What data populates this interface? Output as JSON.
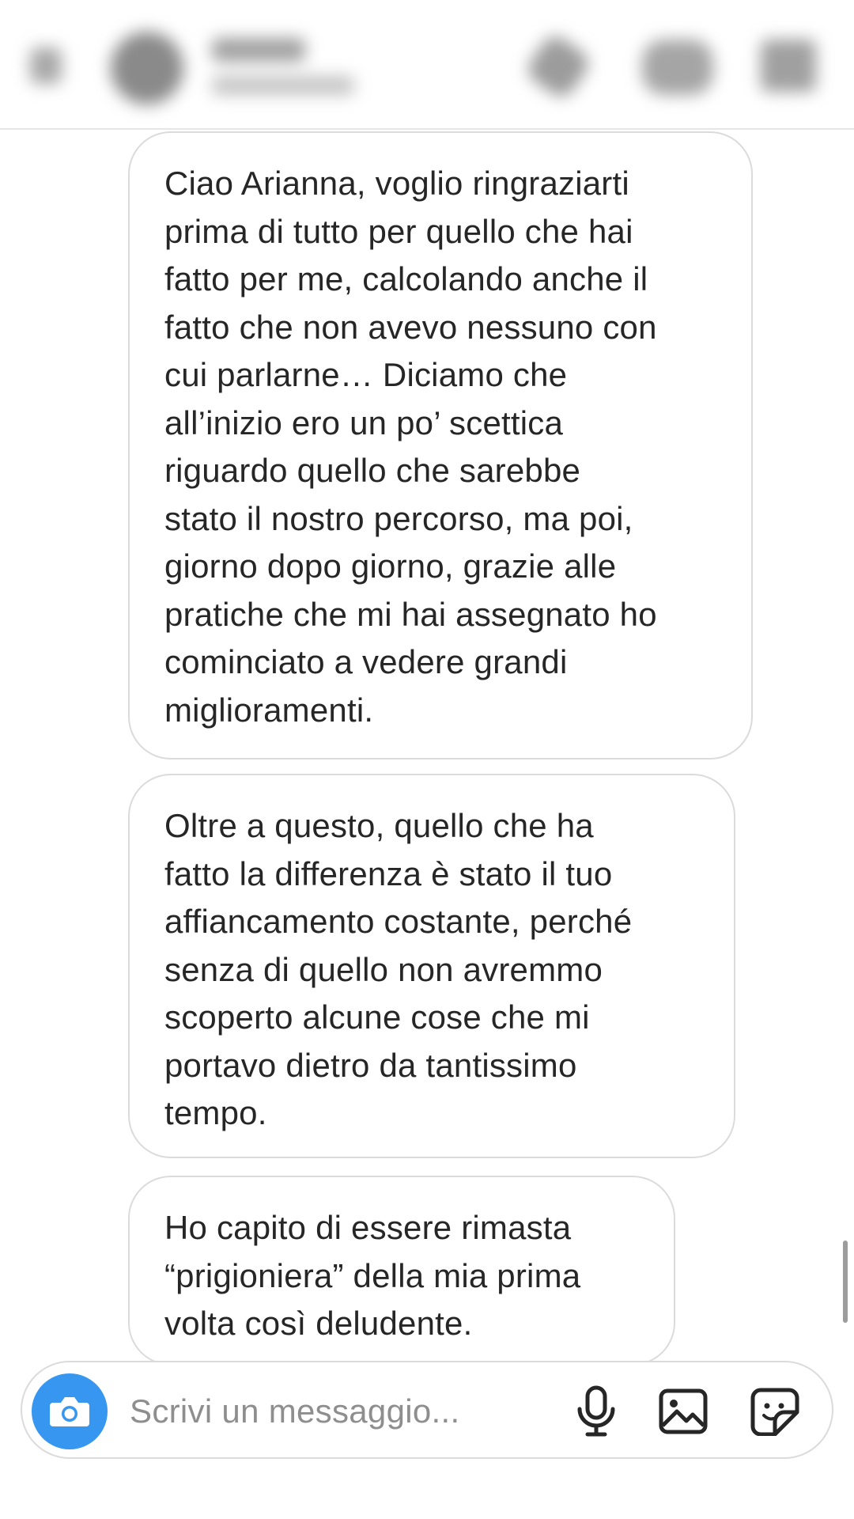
{
  "header": {
    "back_icon": "back-icon",
    "contact_name": "",
    "call_icon": "phone-icon",
    "video_icon": "video-icon",
    "flag_icon": "flag-icon"
  },
  "messages": [
    {
      "text": "Ciao Arianna, voglio ringraziarti\nprima di tutto per quello che hai\nfatto per me, calcolando anche il\nfatto che non avevo nessuno con\ncui parlarne… Diciamo che\nall’inizio ero un po’ scettica\nriguardo quello che sarebbe\nstato il nostro percorso, ma poi,\ngiorno dopo giorno, grazie alle\npratiche che mi hai assegnato ho\ncominciato a vedere grandi\nmiglioramenti."
    },
    {
      "text": "Oltre a questo, quello che ha\nfatto la differenza è stato il tuo\naffiancamento costante, perché\nsenza di quello non avremmo\nscoperto alcune cose che mi\nportavo dietro da tantissimo\ntempo."
    },
    {
      "text": "Ho capito di essere rimasta\n“prigioniera” della mia prima\nvolta così deludente."
    }
  ],
  "composer": {
    "placeholder": "Scrivi un messaggio...",
    "camera_icon": "camera-icon",
    "mic_icon": "microphone-icon",
    "gallery_icon": "image-gallery-icon",
    "sticker_icon": "sticker-icon"
  },
  "colors": {
    "accent": "#3797f0",
    "bubble_border": "#dbdbdb",
    "text": "#262626",
    "placeholder": "#8e8e8e"
  }
}
